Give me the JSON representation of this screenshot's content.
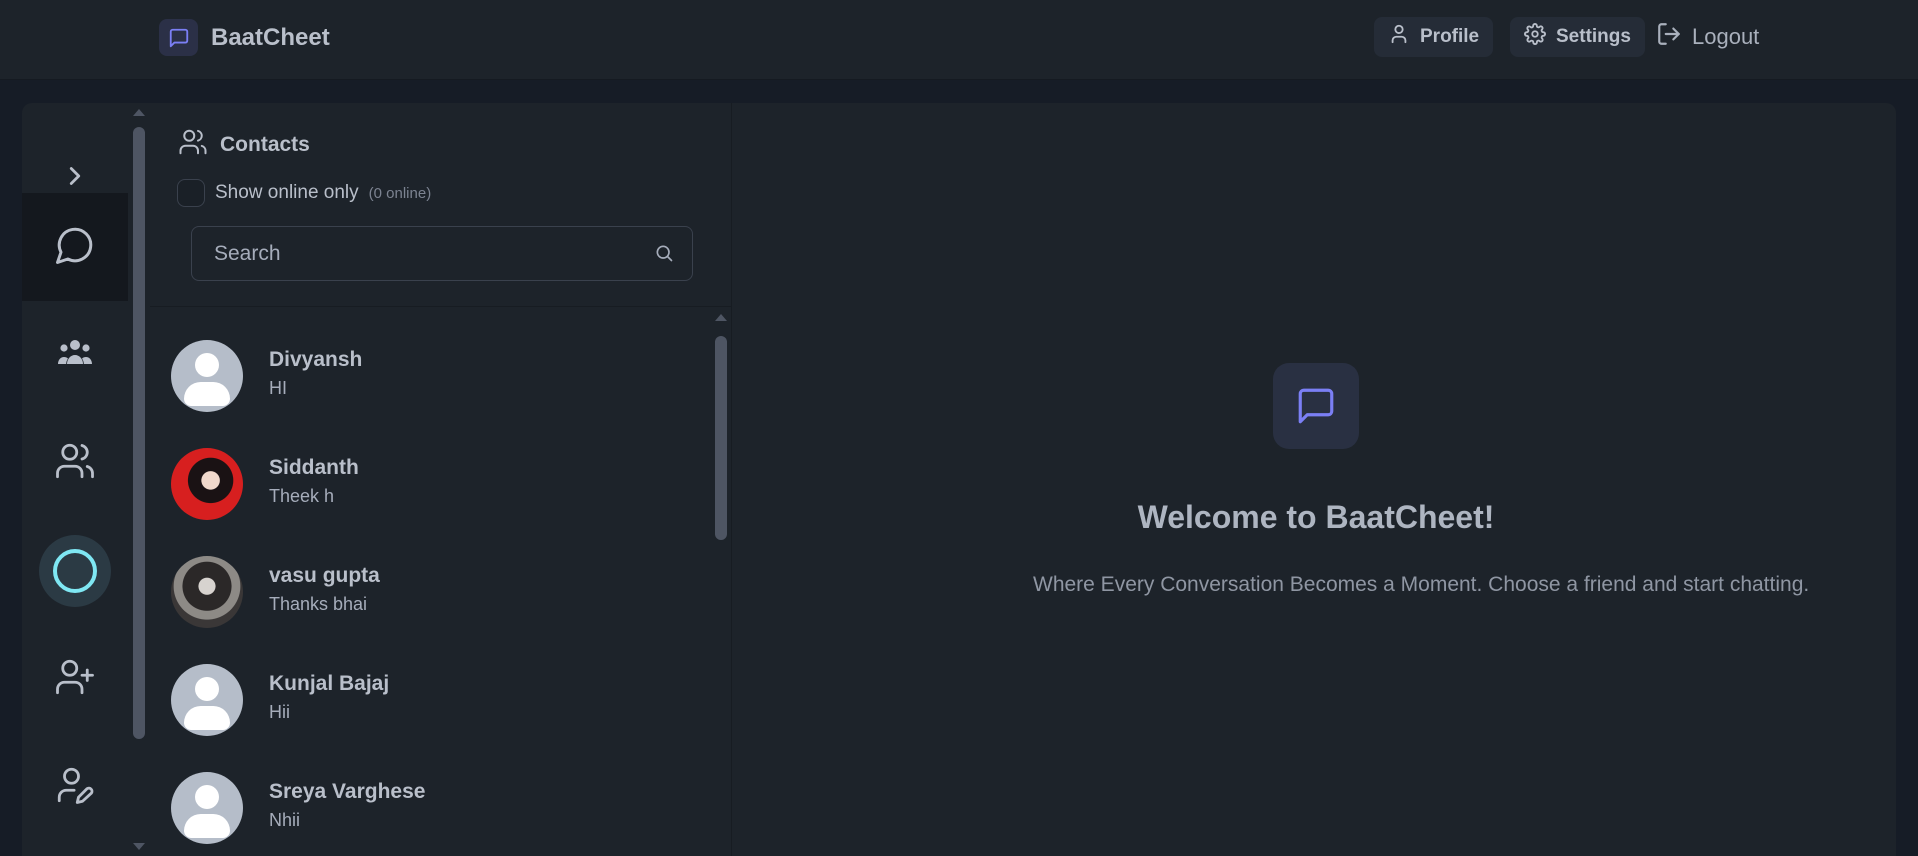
{
  "app": {
    "name": "BaatCheet"
  },
  "nav": {
    "profile_label": "Profile",
    "settings_label": "Settings",
    "logout_label": "Logout"
  },
  "rail": {
    "items": [
      "expand",
      "chats",
      "groups",
      "contacts",
      "status",
      "add-friend",
      "edit-profile"
    ],
    "active": "chats"
  },
  "contacts": {
    "title": "Contacts",
    "online_toggle_label": "Show online only",
    "online_count": "(0 online)",
    "search_placeholder": "Search",
    "list": [
      {
        "name": "Divyansh",
        "last_message": "HI",
        "avatar": "default"
      },
      {
        "name": "Siddanth",
        "last_message": "Theek h",
        "avatar": "photo"
      },
      {
        "name": "vasu gupta",
        "last_message": "Thanks bhai",
        "avatar": "photo"
      },
      {
        "name": "Kunjal Bajaj",
        "last_message": "Hii",
        "avatar": "default"
      },
      {
        "name": "Sreya Varghese",
        "last_message": "Nhii",
        "avatar": "default"
      }
    ]
  },
  "welcome": {
    "title": "Welcome to BaatCheet!",
    "subtitle": "Where Every Conversation Becomes a Moment. Choose a friend and start chatting."
  },
  "colors": {
    "accent": "#7b7ff5",
    "status_ring": "#7fe7f3",
    "background": "#1d232a"
  }
}
